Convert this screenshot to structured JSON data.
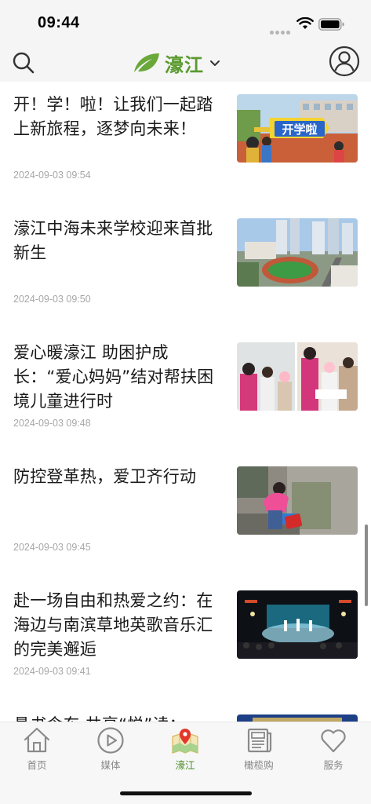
{
  "status_bar": {
    "time": "09:44",
    "icons": [
      "signal-dots-icon",
      "wifi-icon",
      "battery-icon"
    ]
  },
  "header": {
    "title": "濠江",
    "icons": [
      "search-icon",
      "leaf-logo-icon",
      "chevron-down-icon",
      "user-avatar-icon"
    ],
    "accent_color": "#5a9a2e"
  },
  "articles": [
    {
      "title": "开！学！啦！让我们一起踏上新旅程，逐梦向未来！",
      "time": "2024-09-03 09:54",
      "thumb_text": "开学啦"
    },
    {
      "title": "濠江中海未来学校迎来首批新生",
      "time": "2024-09-03 09:50"
    },
    {
      "title": "爱心暖濠江 助困护成长：“爱心妈妈”结对帮扶困境儿童进行时",
      "time": "2024-09-03 09:48"
    },
    {
      "title": "防控登革热，爱卫齐行动",
      "time": "2024-09-03 09:45"
    },
    {
      "title": "赴一场自由和热爱之约：在海边与南滨草地英歌音乐汇的完美邂逅",
      "time": "2024-09-03 09:41"
    },
    {
      "title": "悬书含东 共享“悦”读：",
      "time": ""
    }
  ],
  "tabs": [
    {
      "label": "首页",
      "icon": "home-icon"
    },
    {
      "label": "媒体",
      "icon": "play-circle-icon"
    },
    {
      "label": "濠江",
      "icon": "map-pin-icon",
      "active": true
    },
    {
      "label": "橄榄购",
      "icon": "newspaper-icon"
    },
    {
      "label": "服务",
      "icon": "heart-icon"
    }
  ]
}
